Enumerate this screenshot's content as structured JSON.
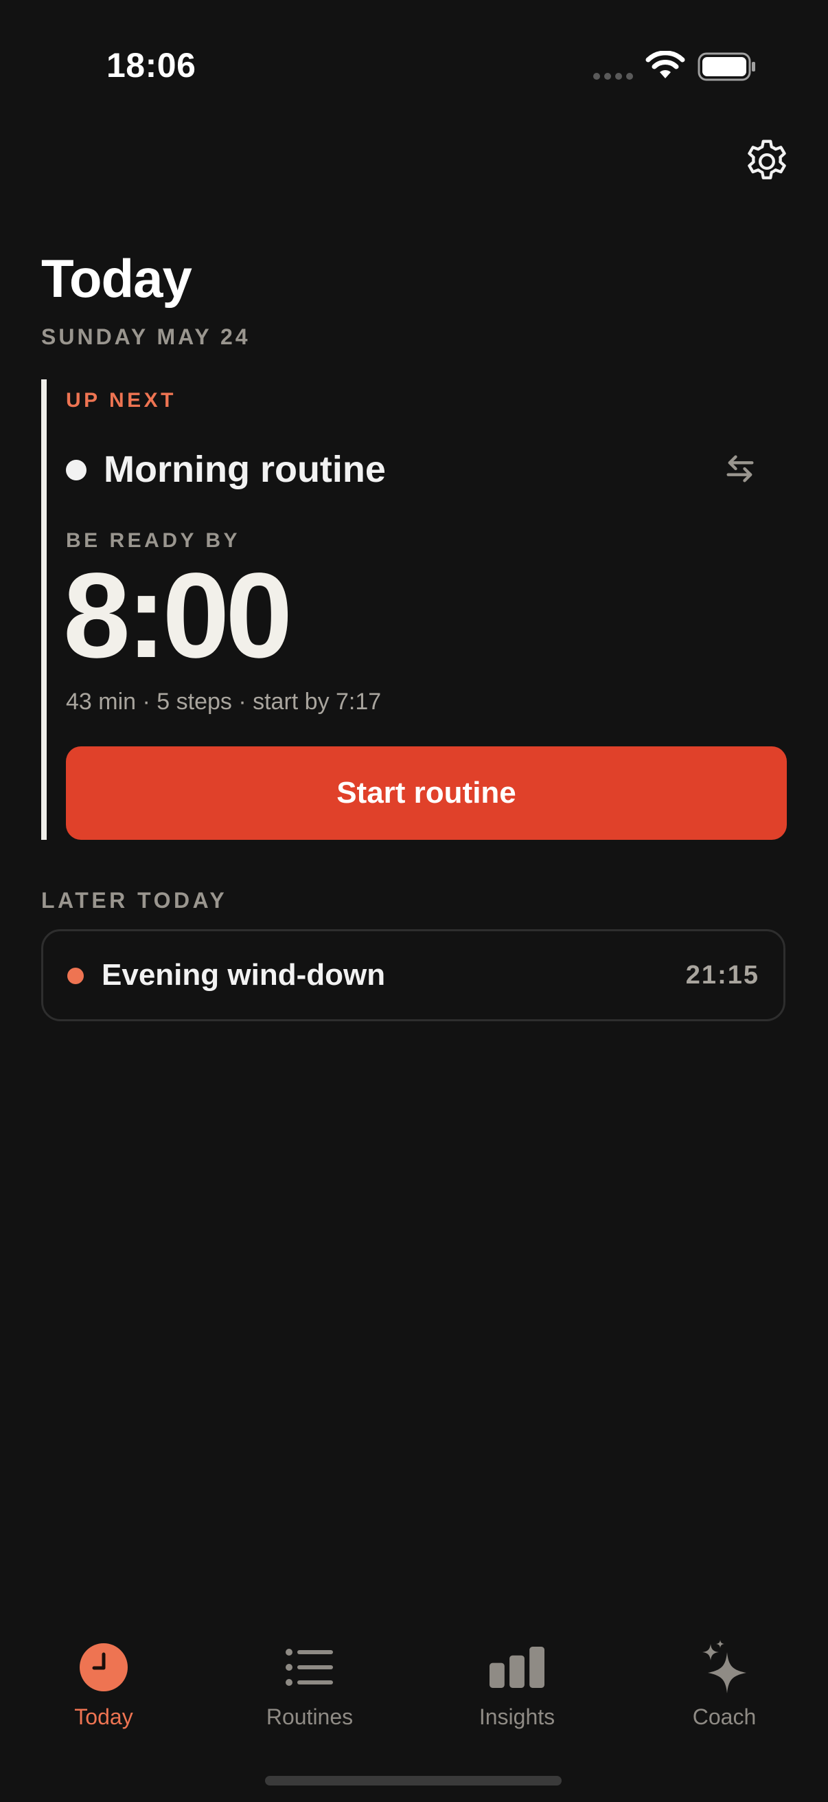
{
  "status_bar": {
    "time": "18:06"
  },
  "header": {
    "title": "Today",
    "date": "SUNDAY MAY 24"
  },
  "up_next": {
    "label": "UP NEXT",
    "routine_name": "Morning routine",
    "ready_by_label": "BE READY BY",
    "ready_time": "8:00",
    "meta": "43 min · 5 steps · start by 7:17",
    "start_button_label": "Start routine"
  },
  "later_today": {
    "label": "LATER TODAY",
    "items": [
      {
        "name": "Evening wind-down",
        "time": "21:15"
      }
    ]
  },
  "tab_bar": {
    "tabs": [
      {
        "label": "Today",
        "icon": "clock-icon",
        "active": true
      },
      {
        "label": "Routines",
        "icon": "list-icon",
        "active": false
      },
      {
        "label": "Insights",
        "icon": "bar-chart-icon",
        "active": false
      },
      {
        "label": "Coach",
        "icon": "sparkle-icon",
        "active": false
      }
    ]
  },
  "colors": {
    "background": "#121212",
    "accent": "#ee7452",
    "button": "#e0412a",
    "muted_text": "#9a968f"
  }
}
